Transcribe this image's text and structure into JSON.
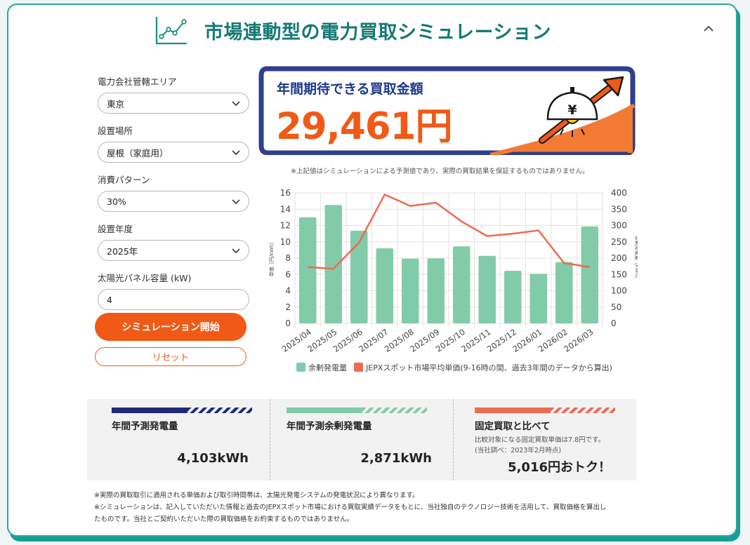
{
  "header": {
    "title": "市場連動型の電力買取シミュレーション",
    "icon": "chart-line-icon",
    "collapse_icon": "chevron-up-icon"
  },
  "form": {
    "area": {
      "label": "電力会社管轄エリア",
      "value": "東京"
    },
    "location": {
      "label": "設置場所",
      "value": "屋根（家庭用）"
    },
    "pattern": {
      "label": "消費パターン",
      "value": "30%"
    },
    "year": {
      "label": "設置年度",
      "value": "2025年"
    },
    "capacity": {
      "label": "太陽光パネル容量 (kW)",
      "value": "4"
    },
    "start_button": "シミュレーション開始",
    "reset_button": "リセット"
  },
  "result": {
    "label": "年間期待できる買取金額",
    "amount": "29,461円",
    "illustration": "yen-bulb-rising-arrow-icon",
    "disclaimer": "※上記値はシミュレーションによる予測値であり、実際の買取結果を保証するものではありません。"
  },
  "chart_data": {
    "type": "bar",
    "categories": [
      "2025/04",
      "2025/05",
      "2025/06",
      "2025/07",
      "2025/08",
      "2025/09",
      "2025/10",
      "2025/11",
      "2025/12",
      "2026/01",
      "2026/02",
      "2026/03"
    ],
    "series": [
      {
        "name": "余剰発電量",
        "type": "bar",
        "axis": "right",
        "values": [
          325,
          363,
          284,
          230,
          198,
          199,
          236,
          207,
          161,
          152,
          188,
          297
        ],
        "color": "#82cba8"
      },
      {
        "name": "JEPXスポット市場平均単価(9-16時の間、過去3年間のデータから算出)",
        "type": "line",
        "axis": "left",
        "values": [
          6.9,
          6.7,
          9.9,
          15.8,
          14.4,
          14.8,
          12.5,
          10.7,
          11.0,
          11.4,
          7.4,
          6.9
        ],
        "color": "#ef6b50"
      }
    ],
    "y_left": {
      "label": "単価［円/kWh］",
      "ticks": [
        "0",
        "2",
        "4",
        "6",
        "8",
        "10",
        "12",
        "14",
        "16"
      ],
      "lim": [
        0,
        16
      ]
    },
    "y_right": {
      "label": "余剰発電量［kWh］",
      "ticks": [
        "0",
        "50",
        "100",
        "150",
        "200",
        "250",
        "300",
        "350",
        "400"
      ],
      "lim": [
        0,
        400
      ]
    },
    "grid": true,
    "legend": "bottom"
  },
  "summary": {
    "annual_generation": {
      "title": "年間予測発電量",
      "value": "4,103kWh",
      "color": "#1d2b7a"
    },
    "annual_surplus": {
      "title": "年間予測余剰発電量",
      "value": "2,871kWh",
      "color": "#82cba8"
    },
    "fixed_compare": {
      "title": "固定買取と比べて",
      "note1": "比較対象になる固定買取単価は7.8円です。",
      "note2": "(当社調べ：2023年2月時点)",
      "value": "5,016円おトク！",
      "color": "#ef6b50"
    }
  },
  "footnotes": {
    "line1": "※実際の買取取引に適用される単価および取引時間帯は、太陽光発電システムの発電状況により異なります。",
    "line2": "※シミュレーションは、記入していただいた情報と過去のJEPXスポット市場における買取実績データをもとに、当社独自のテクノロジー技術を活用して、買取価格を算出し",
    "line3": "たものです。当社とご契約いただいた際の買取価格をお約束するものではありません。"
  }
}
